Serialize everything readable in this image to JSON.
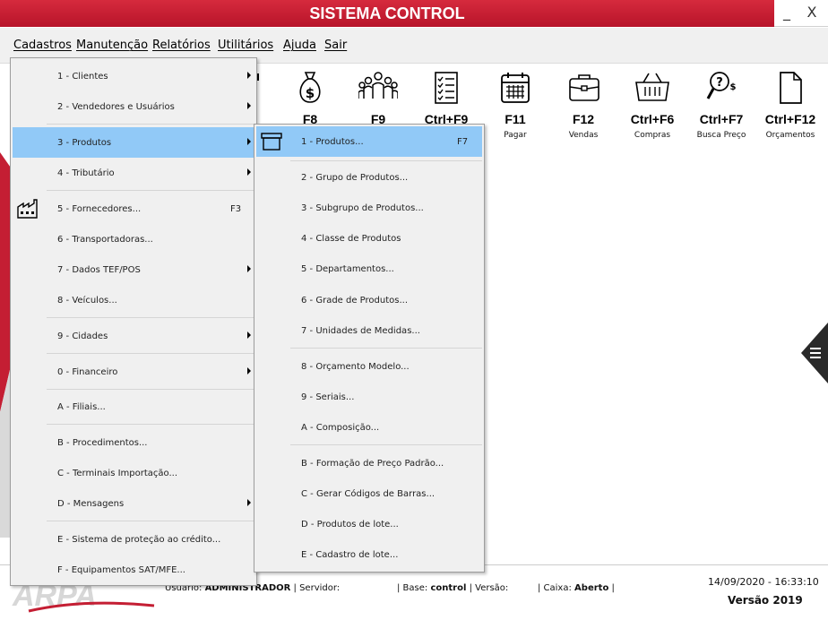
{
  "window": {
    "title": "SISTEMA CONTROL",
    "minimize": "_",
    "close": "X"
  },
  "menubar": [
    "Cadastros",
    "Manutenção",
    "Relatórios",
    "Utilitários",
    "Ajuda",
    "Sair"
  ],
  "toolbar": [
    {
      "key": "F8",
      "label": "",
      "icon": "money-bag-icon"
    },
    {
      "key": "F9",
      "label": "",
      "icon": "people-group-icon"
    },
    {
      "key": "Ctrl+F9",
      "label": "",
      "icon": "checklist-icon"
    },
    {
      "key": "F11",
      "label": "Pagar",
      "icon": "calendar-icon"
    },
    {
      "key": "F12",
      "label": "Vendas",
      "icon": "briefcase-icon"
    },
    {
      "key": "Ctrl+F6",
      "label": "Compras",
      "icon": "basket-icon"
    },
    {
      "key": "Ctrl+F7",
      "label": "Busca Preço",
      "icon": "price-search-icon"
    },
    {
      "key": "Ctrl+F12",
      "label": "Orçamentos",
      "icon": "document-icon"
    }
  ],
  "cadastros_menu": [
    {
      "label": "1 - Clientes",
      "submenu": true
    },
    {
      "label": "2 - Vendedores e Usuários",
      "submenu": true
    },
    {
      "label": "3 - Produtos",
      "submenu": true,
      "highlighted": true
    },
    {
      "label": "4 - Tributário",
      "submenu": true
    },
    {
      "label": "5 - Fornecedores...",
      "shortcut": "F3",
      "icon": "factory-icon"
    },
    {
      "label": "6 - Transportadoras..."
    },
    {
      "label": "7 - Dados TEF/POS",
      "submenu": true
    },
    {
      "label": "8 - Veículos..."
    },
    {
      "label": "9 - Cidades",
      "submenu": true
    },
    {
      "label": "0 - Financeiro",
      "submenu": true
    },
    {
      "label": "A - Filiais..."
    },
    {
      "label": "B - Procedimentos..."
    },
    {
      "label": "C - Terminais Importação..."
    },
    {
      "label": "D - Mensagens",
      "submenu": true
    },
    {
      "label": "E - Sistema de proteção ao crédito..."
    },
    {
      "label": "F - Equipamentos SAT/MFE..."
    }
  ],
  "produtos_menu": [
    {
      "label": "1 - Produtos...",
      "shortcut": "F7",
      "highlighted": true,
      "icon": "box-icon"
    },
    {
      "label": "2 - Grupo de Produtos..."
    },
    {
      "label": "3 - Subgrupo de Produtos..."
    },
    {
      "label": "4 - Classe de Produtos"
    },
    {
      "label": "5 - Departamentos..."
    },
    {
      "label": "6 - Grade de Produtos..."
    },
    {
      "label": "7 - Unidades de Medidas..."
    },
    {
      "label": "8 - Orçamento Modelo..."
    },
    {
      "label": "9 - Seriais..."
    },
    {
      "label": "A - Composição..."
    },
    {
      "label": "B - Formação de Preço Padrão..."
    },
    {
      "label": "C - Gerar Códigos de Barras..."
    },
    {
      "label": "D - Produtos de lote..."
    },
    {
      "label": "E - Cadastro de lote..."
    }
  ],
  "status": {
    "logo": "ARPA",
    "usuario_label": "Usuário:",
    "usuario": "ADMINISTRADOR",
    "servidor_label": "| Servidor:",
    "base_label": "| Base:",
    "base": "control",
    "versao_label": "| Versão:",
    "caixa_label": "| Caixa:",
    "caixa": "Aberto",
    "caixa_end": "|",
    "datetime": "14/09/2020 - 16:33:10",
    "version": "Versão 2019"
  },
  "colors": {
    "title_red": "#c41e33",
    "highlight": "#91c9f7",
    "menu_bg": "#f0f0f0"
  }
}
